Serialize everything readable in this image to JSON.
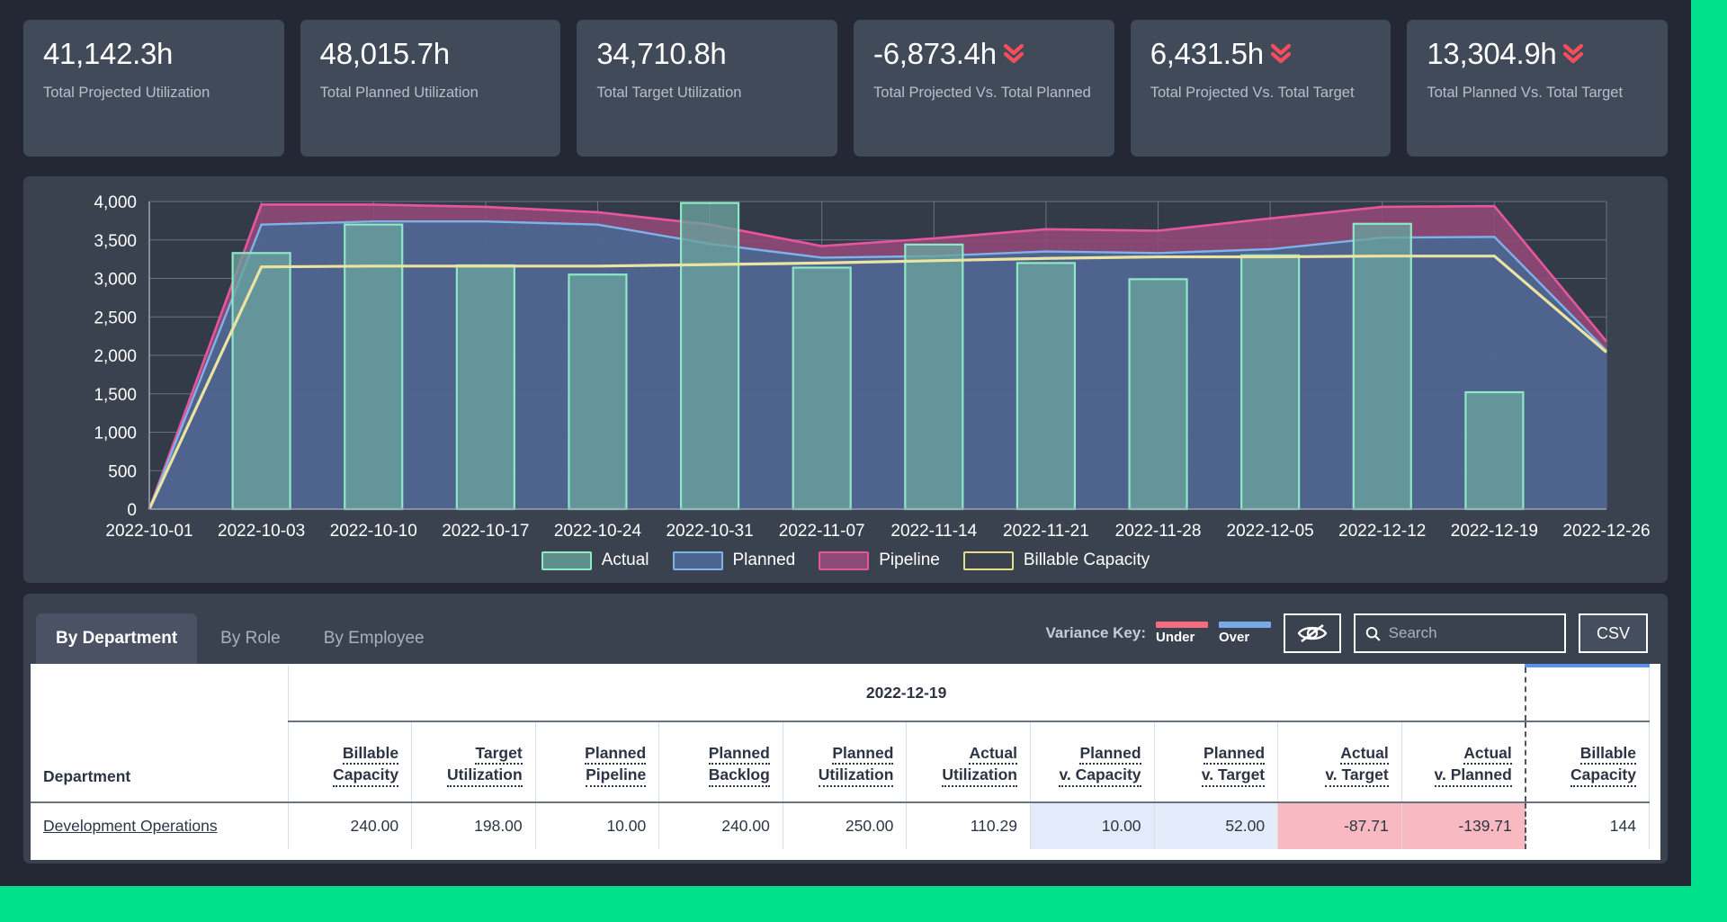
{
  "kpis": [
    {
      "value": "41,142.3h",
      "label": "Total Projected Utilization",
      "trend": "none"
    },
    {
      "value": "48,015.7h",
      "label": "Total Planned Utilization",
      "trend": "none"
    },
    {
      "value": "34,710.8h",
      "label": "Total Target Utilization",
      "trend": "none"
    },
    {
      "value": "-6,873.4h",
      "label": "Total Projected Vs. Total Planned",
      "trend": "down",
      "trend_icon": "double-chevron-down-icon"
    },
    {
      "value": "6,431.5h",
      "label": "Total Projected Vs. Total Target",
      "trend": "down",
      "trend_icon": "double-chevron-down-icon"
    },
    {
      "value": "13,304.9h",
      "label": "Total Planned Vs. Total Target",
      "trend": "down",
      "trend_icon": "double-chevron-down-icon"
    }
  ],
  "chart_data": {
    "type": "area",
    "title": "",
    "xlabel": "",
    "ylabel": "",
    "ylim": [
      0,
      4000
    ],
    "ytick_labels": [
      "0",
      "500",
      "1,000",
      "1,500",
      "2,000",
      "2,500",
      "3,000",
      "3,500",
      "4,000"
    ],
    "ytick_values": [
      0,
      500,
      1000,
      1500,
      2000,
      2500,
      3000,
      3500,
      4000
    ],
    "grid": true,
    "legend_position": "bottom",
    "categories": [
      "2022-10-01",
      "2022-10-03",
      "2022-10-10",
      "2022-10-17",
      "2022-10-24",
      "2022-10-31",
      "2022-11-07",
      "2022-11-14",
      "2022-11-21",
      "2022-11-28",
      "2022-12-05",
      "2022-12-12",
      "2022-12-19",
      "2022-12-26"
    ],
    "series": [
      {
        "name": "Actual",
        "kind": "bar",
        "color": "#6aa39e",
        "border": "#8fe8c4",
        "values": [
          0,
          3330,
          3700,
          3170,
          3050,
          3980,
          3140,
          3440,
          3200,
          2990,
          3300,
          3710,
          1520,
          0
        ]
      },
      {
        "name": "Planned",
        "kind": "area",
        "color": "#4c6590",
        "border": "#7eb2e8",
        "values": [
          0,
          3700,
          3740,
          3740,
          3700,
          3450,
          3270,
          3290,
          3350,
          3330,
          3380,
          3530,
          3540,
          2060
        ]
      },
      {
        "name": "Pipeline",
        "kind": "area",
        "color": "#8d4a77",
        "border": "#e8559f",
        "values": [
          0,
          3960,
          3960,
          3930,
          3860,
          3700,
          3420,
          3520,
          3640,
          3620,
          3780,
          3930,
          3940,
          2180
        ]
      },
      {
        "name": "Billable Capacity",
        "kind": "line",
        "color": "#eae4a0",
        "border": "#eae4a0",
        "values": [
          0,
          3150,
          3160,
          3160,
          3160,
          3180,
          3200,
          3230,
          3260,
          3280,
          3280,
          3290,
          3290,
          2040
        ]
      }
    ],
    "legend": [
      {
        "label": "Actual",
        "fill": "#5e8f8a",
        "stroke": "#8fe8c4"
      },
      {
        "label": "Planned",
        "fill": "#4c6590",
        "stroke": "#7eb2e8"
      },
      {
        "label": "Pipeline",
        "fill": "#8d4a77",
        "stroke": "#e8559f"
      },
      {
        "label": "Billable Capacity",
        "fill": "transparent",
        "stroke": "#e7dc8a"
      }
    ]
  },
  "table_section": {
    "tabs": [
      {
        "label": "By Department",
        "active": true
      },
      {
        "label": "By Role",
        "active": false
      },
      {
        "label": "By Employee",
        "active": false
      }
    ],
    "variance_key": {
      "title": "Variance Key:",
      "entries": [
        {
          "label": "Under",
          "color": "#f46d7e"
        },
        {
          "label": "Over",
          "color": "#7aa9e8"
        }
      ]
    },
    "hide_button_icon": "eye-off-icon",
    "search": {
      "placeholder": "Search",
      "value": ""
    },
    "csv_button": "CSV",
    "group_header_date": "2022-12-19",
    "first_column_header": "Department",
    "columns": [
      {
        "line1": "Billable",
        "line2": "Capacity"
      },
      {
        "line1": "Target",
        "line2": "Utilization"
      },
      {
        "line1": "Planned",
        "line2": "Pipeline"
      },
      {
        "line1": "Planned",
        "line2": "Backlog"
      },
      {
        "line1": "Planned",
        "line2": "Utilization"
      },
      {
        "line1": "Actual",
        "line2": "Utilization"
      },
      {
        "line1": "Planned",
        "line2": "v. Capacity"
      },
      {
        "line1": "Planned",
        "line2": "v. Target"
      },
      {
        "line1": "Actual",
        "line2": "v. Target"
      },
      {
        "line1": "Actual",
        "line2": "v. Planned"
      },
      {
        "line1": "Billable",
        "line2": "Capacity"
      }
    ],
    "rows": [
      {
        "department": "Development Operations",
        "cells": [
          {
            "value": "240.00",
            "variance": "none"
          },
          {
            "value": "198.00",
            "variance": "none"
          },
          {
            "value": "10.00",
            "variance": "none"
          },
          {
            "value": "240.00",
            "variance": "none"
          },
          {
            "value": "250.00",
            "variance": "none"
          },
          {
            "value": "110.29",
            "variance": "none"
          },
          {
            "value": "10.00",
            "variance": "over"
          },
          {
            "value": "52.00",
            "variance": "over"
          },
          {
            "value": "-87.71",
            "variance": "under"
          },
          {
            "value": "-139.71",
            "variance": "under"
          },
          {
            "value": "144",
            "variance": "none"
          }
        ]
      }
    ]
  }
}
